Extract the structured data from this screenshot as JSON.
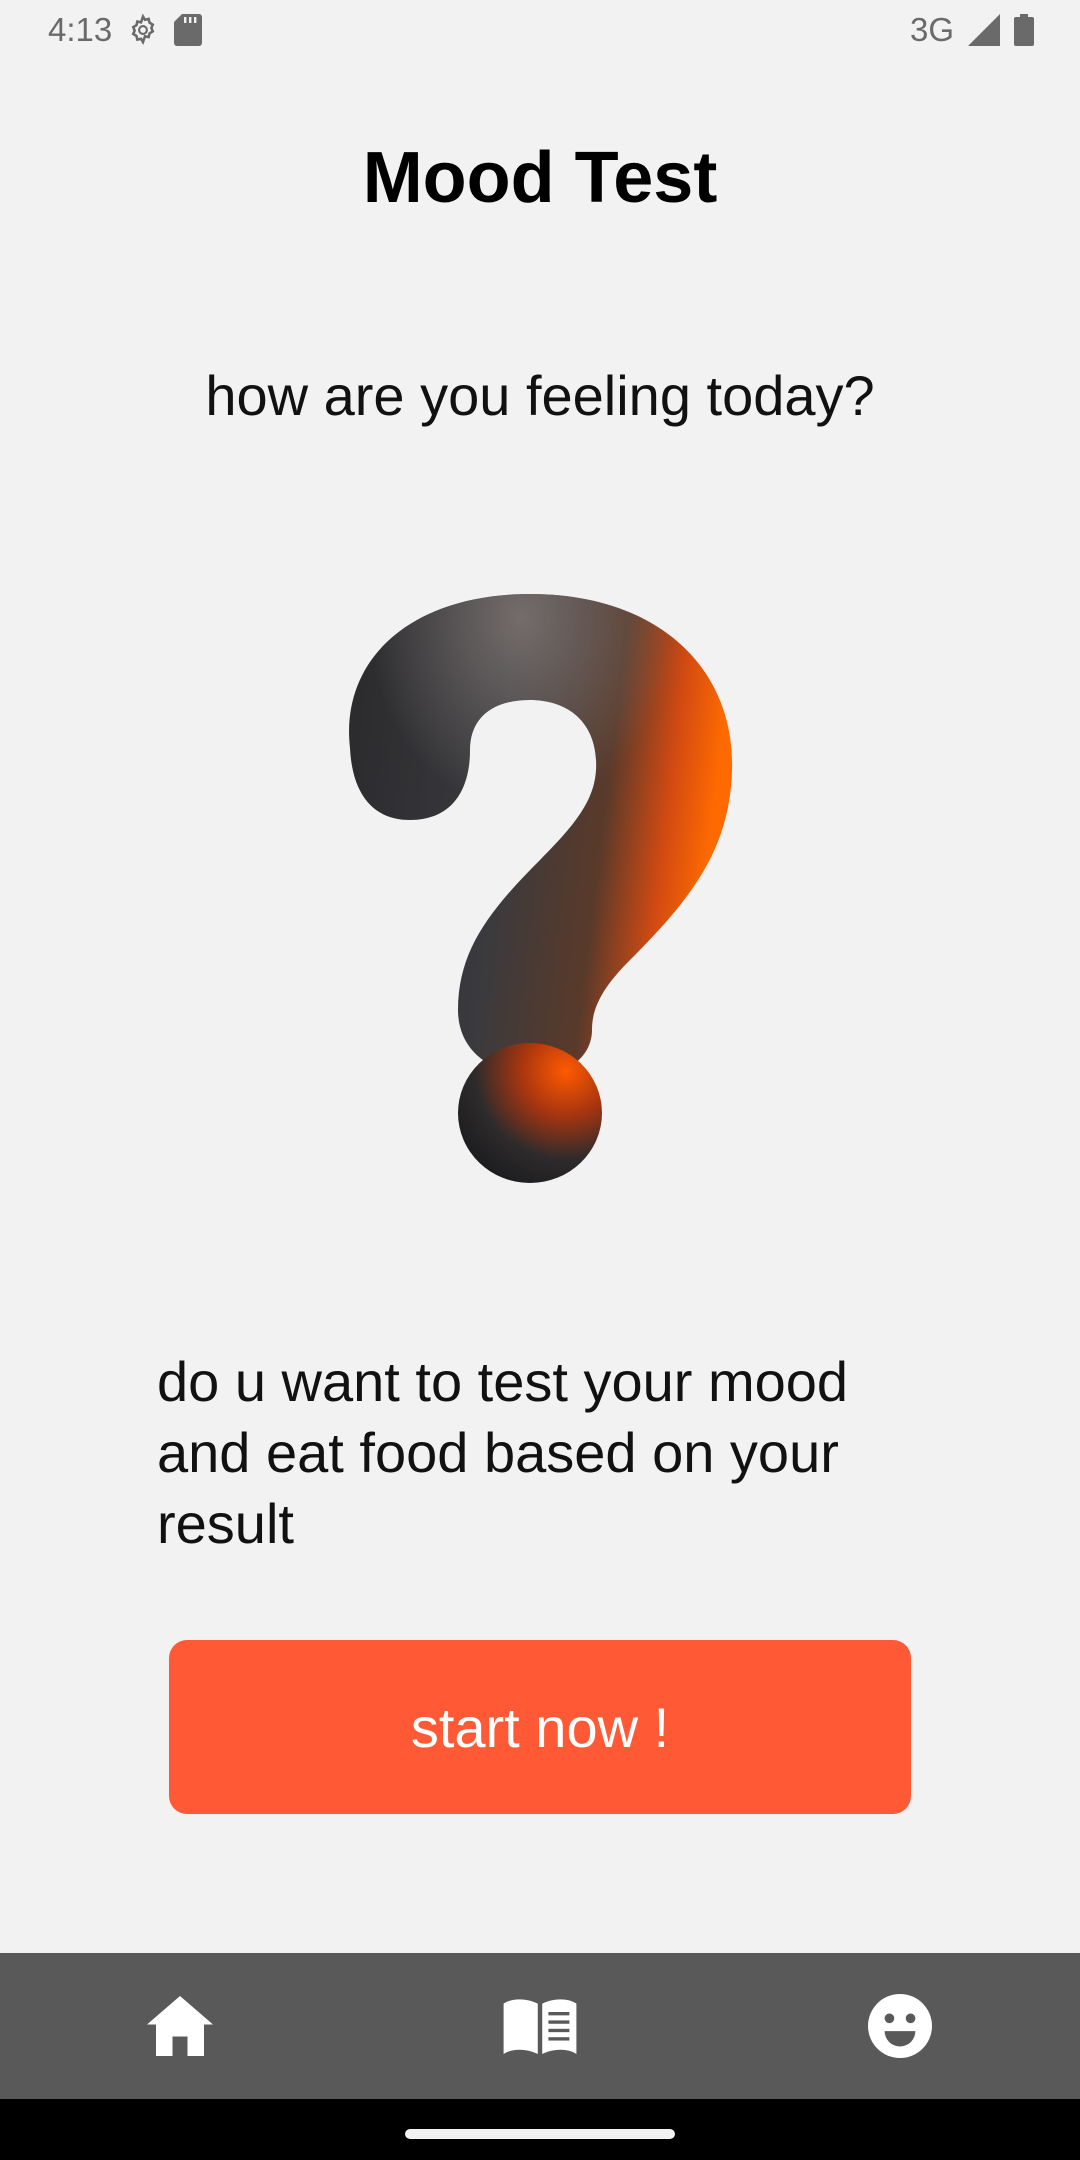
{
  "status_bar": {
    "time": "4:13",
    "network": "3G",
    "icons": [
      "settings-gear-icon",
      "sd-card-icon",
      "cell-signal-icon",
      "battery-icon"
    ]
  },
  "header": {
    "title": "Mood Test"
  },
  "main": {
    "question": "how are you feeling today?",
    "illustration": "question-mark-icon",
    "description": "do u want to test your mood and eat food based on your result",
    "start_label": "start now !"
  },
  "bottom_nav": {
    "items": [
      {
        "icon": "home-icon"
      },
      {
        "icon": "book-icon"
      },
      {
        "icon": "smiley-face-icon"
      }
    ]
  },
  "colors": {
    "accent": "#ff5a35",
    "background": "#f2f2f2",
    "nav_background": "#595959",
    "nav_icon": "#ffffff"
  }
}
